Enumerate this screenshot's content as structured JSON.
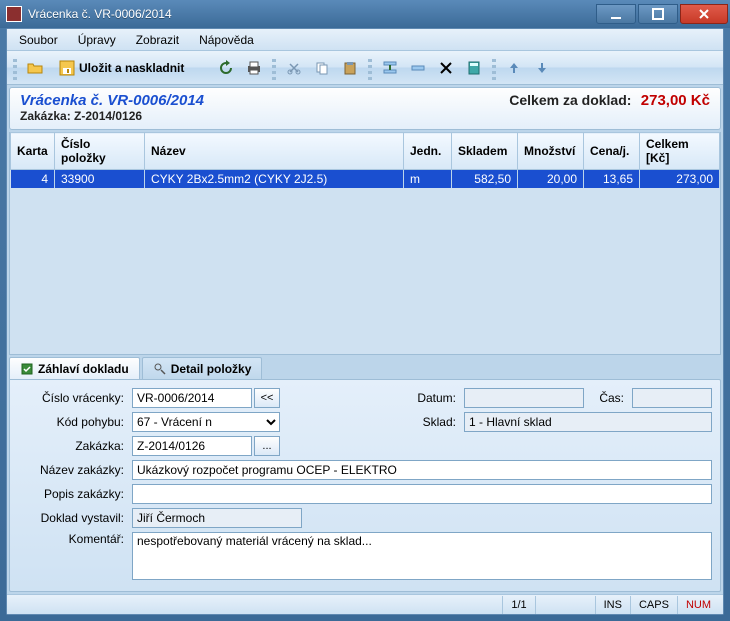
{
  "window": {
    "title": "Vrácenka č. VR-0006/2014"
  },
  "menu": {
    "soubor": "Soubor",
    "upravy": "Úpravy",
    "zobrazit": "Zobrazit",
    "napoveda": "Nápověda"
  },
  "toolbar": {
    "save_and_stock": "Uložit a naskladnit"
  },
  "header": {
    "doc_title": "Vrácenka č. VR-0006/2014",
    "order": "Zakázka: Z-2014/0126",
    "total_label": "Celkem za doklad:",
    "total_value": "273,00 Kč"
  },
  "columns": {
    "card": "Karta",
    "item_no": "Číslo položky",
    "name": "Název",
    "unit": "Jedn.",
    "stock": "Skladem",
    "qty": "Množství",
    "price": "Cena/j.",
    "total": "Celkem [Kč]"
  },
  "rows": [
    {
      "card": "4",
      "item_no": "33900",
      "name": "CYKY 2Bx2.5mm2 (CYKY 2J2.5)",
      "unit": "m",
      "stock": "582,50",
      "qty": "20,00",
      "price": "13,65",
      "total": "273,00"
    }
  ],
  "tabs": {
    "header_tab": "Záhlaví dokladu",
    "detail_tab": "Detail položky"
  },
  "form": {
    "labels": {
      "return_no": "Číslo vrácenky:",
      "move_code": "Kód pohybu:",
      "order": "Zakázka:",
      "order_name": "Název zakázky:",
      "order_desc": "Popis zakázky:",
      "issued_by": "Doklad vystavil:",
      "comment": "Komentář:",
      "date": "Datum:",
      "time": "Čas:",
      "store": "Sklad:"
    },
    "values": {
      "return_no": "VR-0006/2014",
      "move_code": "67 - Vrácení n",
      "order": "Z-2014/0126",
      "order_name": "Ukázkový rozpočet programu OCEP - ELEKTRO",
      "order_desc": "",
      "issued_by": "Jiří Čermoch",
      "comment": "nespotřebovaný materiál vrácený na sklad...",
      "date": "",
      "time": "",
      "store": "1 - Hlavní sklad"
    },
    "btn_prev": "<<",
    "btn_pick": "..."
  },
  "status": {
    "page": "1/1",
    "ins": "INS",
    "caps": "CAPS",
    "num": "NUM"
  }
}
